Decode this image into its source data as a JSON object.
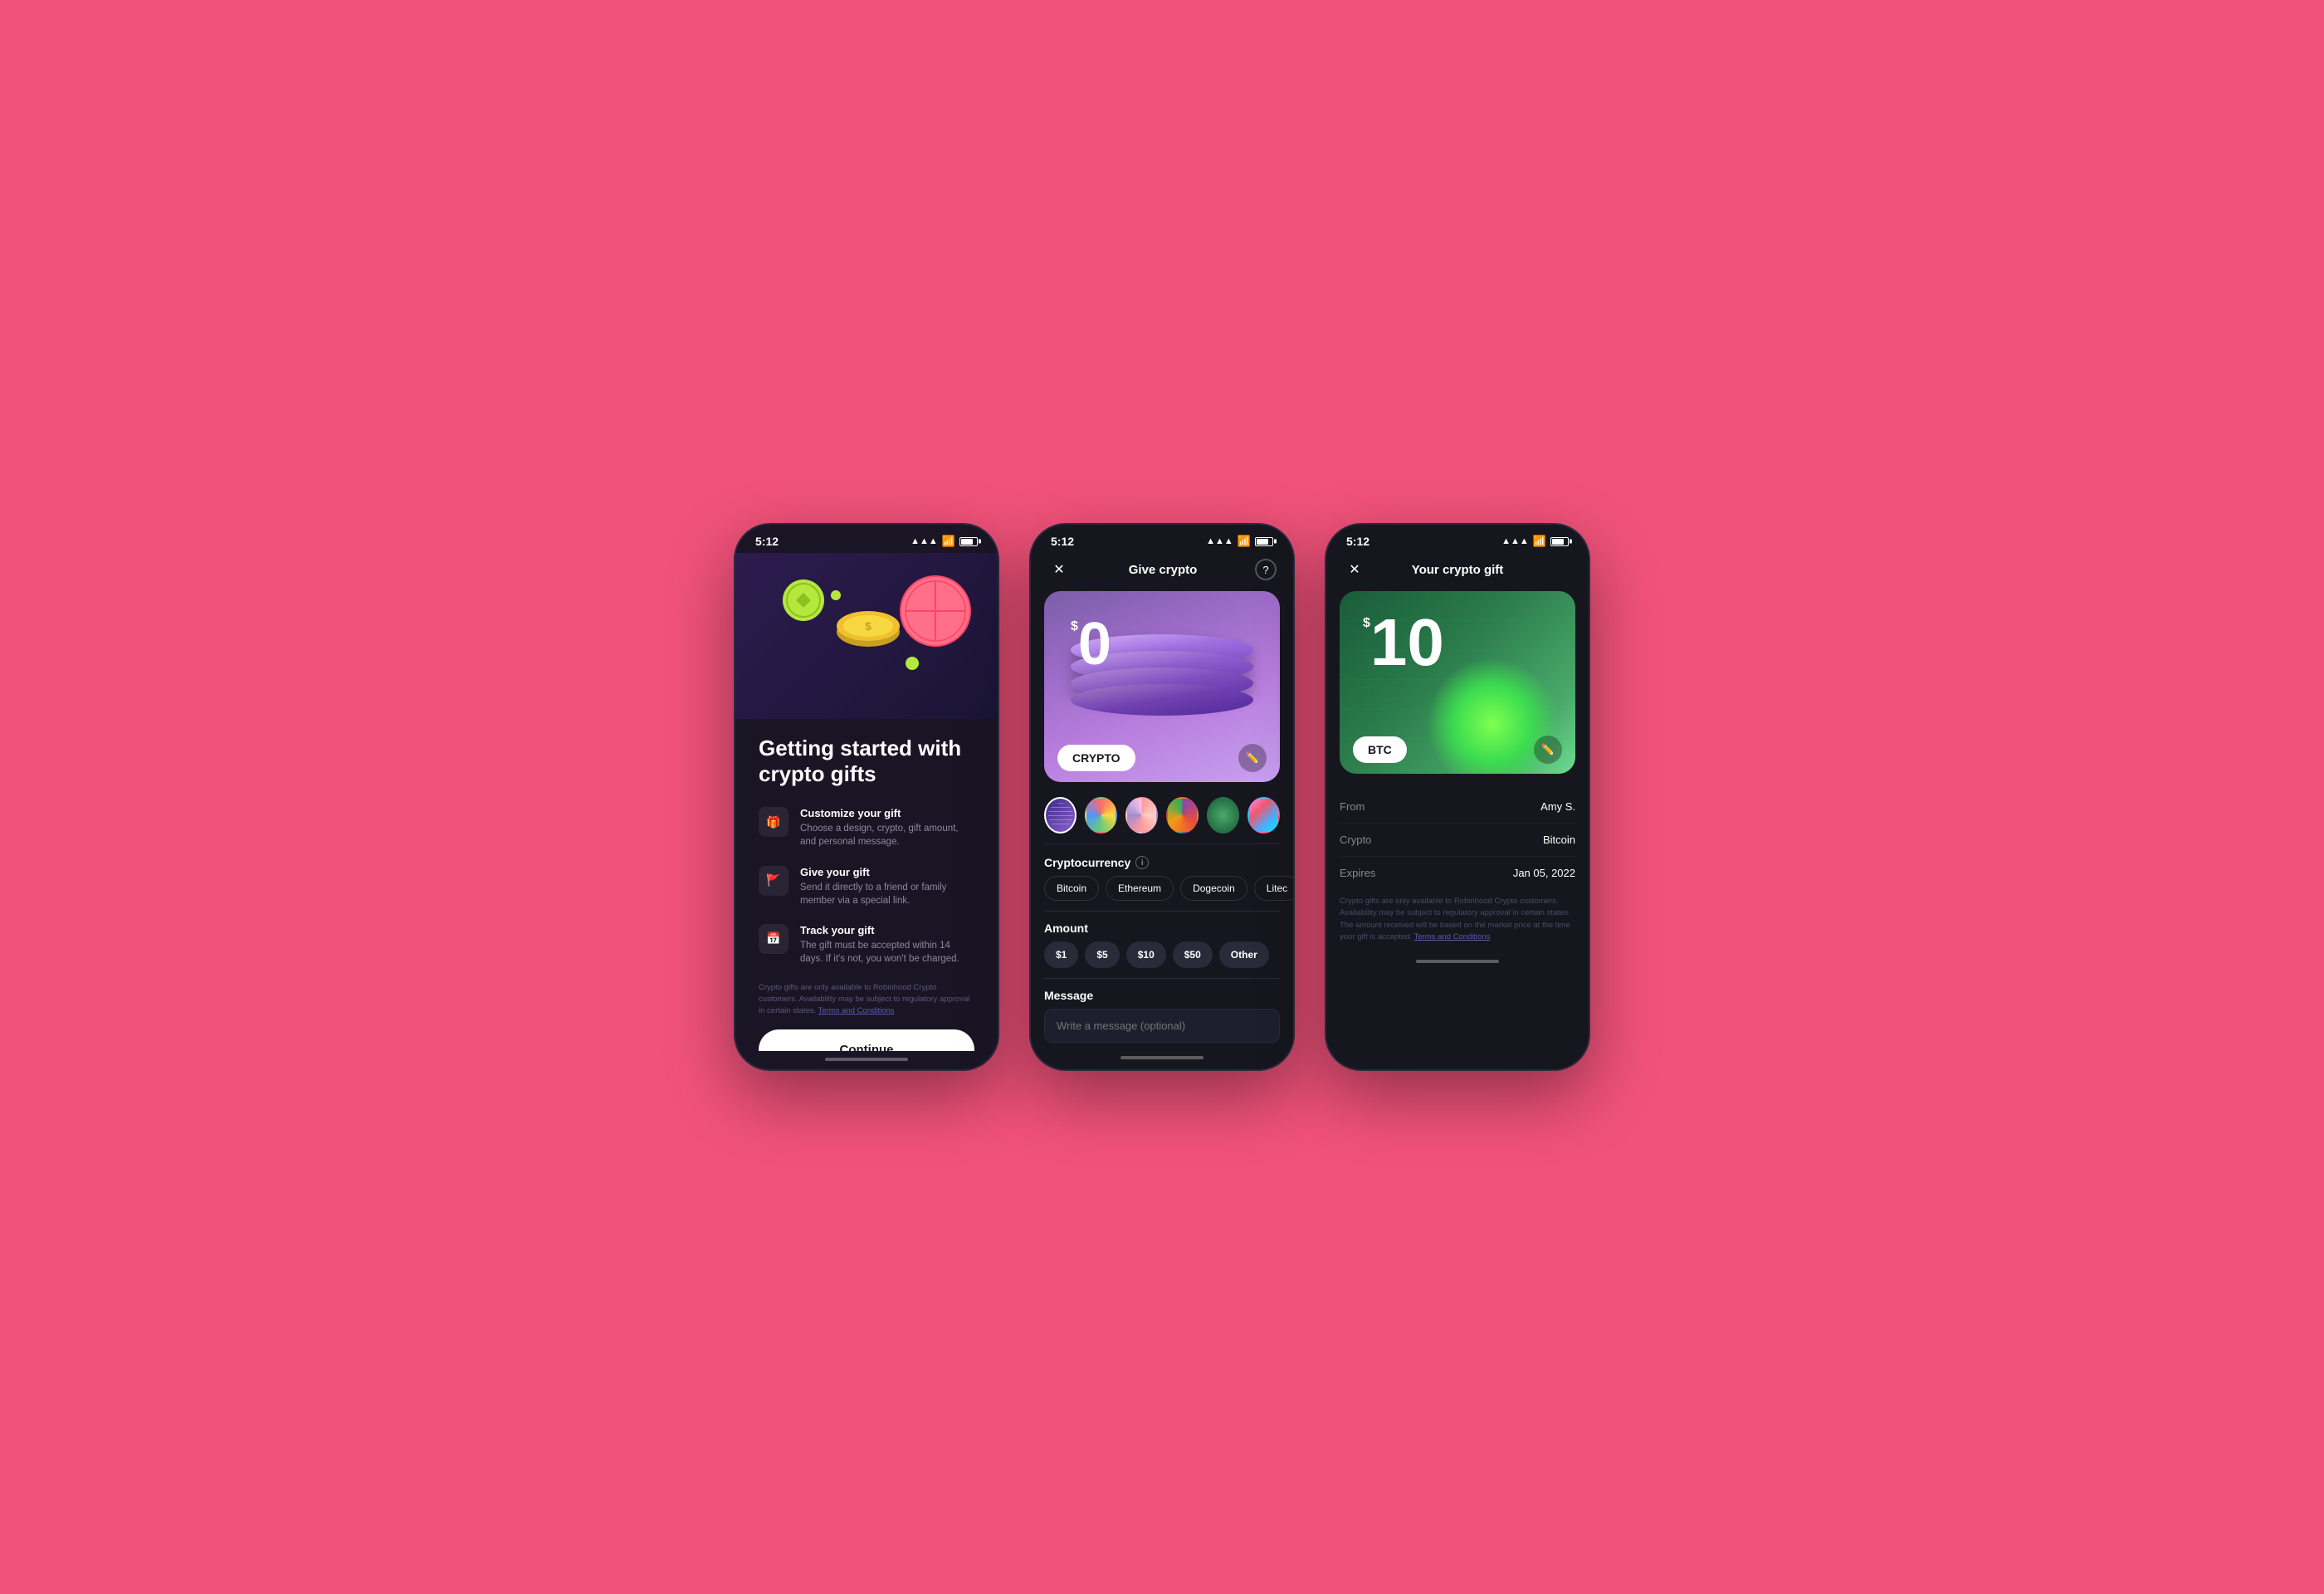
{
  "background": "#F1527A",
  "phone1": {
    "time": "5:12",
    "title": "Getting started with crypto gifts",
    "features": [
      {
        "icon": "🎁",
        "title": "Customize your gift",
        "desc": "Choose a design, crypto, gift amount, and personal message."
      },
      {
        "icon": "🚩",
        "title": "Give your gift",
        "desc": "Send it directly to a friend or family member via a special link."
      },
      {
        "icon": "📅",
        "title": "Track your gift",
        "desc": "The gift must be accepted within 14 days. If it's not, you won't be charged."
      }
    ],
    "disclaimer": "Crypto gifts are only available to Robinhood Crypto customers. Availability may be subject to regulatory approval in certain states.",
    "disclaimer_link": "Terms and Conditions",
    "continue_btn": "Continue"
  },
  "phone2": {
    "time": "5:12",
    "title": "Give crypto",
    "close_label": "✕",
    "help_label": "?",
    "amount": "0",
    "dollar_sign": "$",
    "crypto_label": "CRYPTO",
    "themes": [
      "purple-stripe",
      "colorful1",
      "colorful2",
      "colorful3",
      "green",
      "photo"
    ],
    "sections": {
      "cryptocurrency_label": "Cryptocurrency",
      "coins": [
        "Bitcoin",
        "Ethereum",
        "Dogecoin",
        "Litec"
      ],
      "amount_label": "Amount",
      "amounts": [
        "$1",
        "$5",
        "$10",
        "$50",
        "Other"
      ],
      "message_label": "Message",
      "message_placeholder": "Write a message (optional)"
    }
  },
  "phone3": {
    "time": "5:12",
    "title": "Your crypto gift",
    "close_label": "✕",
    "amount": "10",
    "dollar_sign": "$",
    "crypto_label": "BTC",
    "info_rows": [
      {
        "label": "From",
        "value": "Amy S."
      },
      {
        "label": "Crypto",
        "value": "Bitcoin"
      },
      {
        "label": "Expires",
        "value": "Jan 05, 2022"
      }
    ],
    "disclaimer": "Crypto gifts are only available to Robinhood Crypto customers. Availability may be subject to regulatory approval in certain states. The amount received will be based on the market price at the time your gift is accepted.",
    "disclaimer_link": "Terms and Conditions"
  }
}
